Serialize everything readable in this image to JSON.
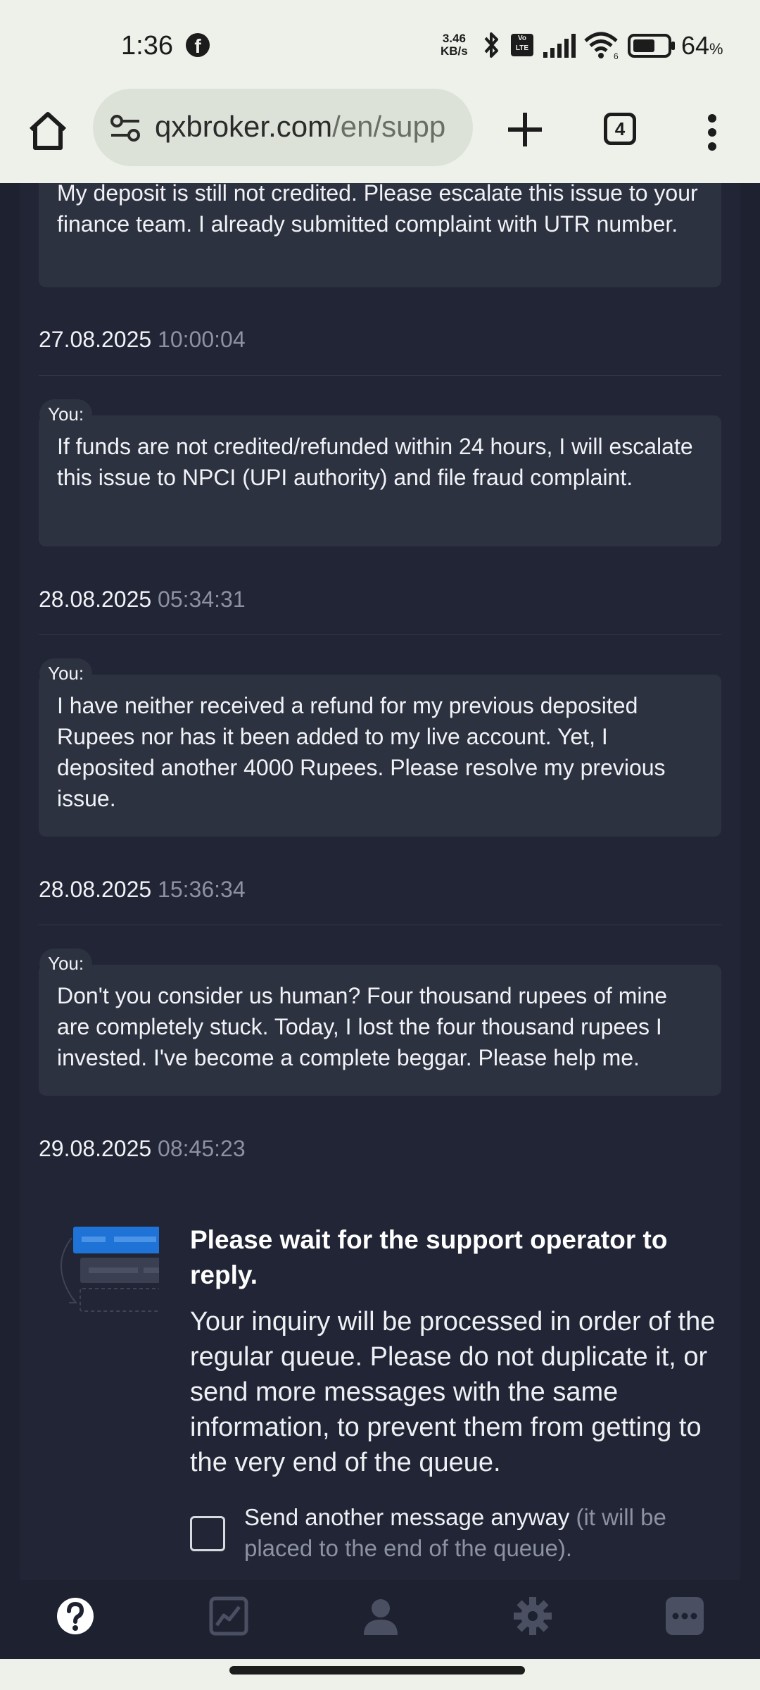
{
  "status_bar": {
    "time": "1:36",
    "net_speed_value": "3.46",
    "net_speed_unit": "KB/s",
    "volte": "Vo LTE",
    "battery_percent": "64",
    "battery_unit": "%"
  },
  "browser": {
    "url_main": "qxbroker.com",
    "url_rest": "/en/supp",
    "tab_count": "4"
  },
  "chat": {
    "you_label": "You:",
    "messages": [
      {
        "text": "My deposit is still not credited. Please escalate this issue to your finance team. I already submitted complaint with UTR number.",
        "date": "27.08.2025",
        "time": "10:00:04"
      },
      {
        "text": "If funds are not credited/refunded within 24 hours, I will escalate this issue to NPCI (UPI authority) and file fraud complaint.",
        "date": "28.08.2025",
        "time": "05:34:31"
      },
      {
        "text": "I have neither received a refund for my previous deposited Rupees nor has it been added to my live account. Yet, I deposited another 4000 Rupees. Please resolve my previous issue.",
        "date": "28.08.2025",
        "time": "15:36:34"
      },
      {
        "text": "Don't you consider us human? Four thousand rupees of mine are completely stuck. Today, I lost the four thousand rupees I invested. I've become a complete beggar. Please help me.",
        "date": "29.08.2025",
        "time": "08:45:23"
      }
    ],
    "wait_title": "Please wait for the support operator to reply.",
    "wait_body": "Your inquiry will be processed in order of the regular queue. Please do not duplicate it, or send more messages with the same information, to prevent them from getting to the very end of the queue.",
    "checkbox_label": "Send another message anyway",
    "checkbox_note": "(it will be placed to the end of the queue).",
    "checkbox_checked": false
  },
  "bottom_nav": {
    "items": [
      "help-icon",
      "chart-icon",
      "user-icon",
      "settings-icon",
      "more-icon"
    ],
    "active": "help-icon"
  },
  "colors": {
    "page_bg": "#1d2130",
    "chat_bg": "#212535",
    "bubble_bg": "#2d3241",
    "muted_text": "#8c92a3",
    "browser_bar": "#eef1ea",
    "accent_blue": "#1f73d6"
  }
}
